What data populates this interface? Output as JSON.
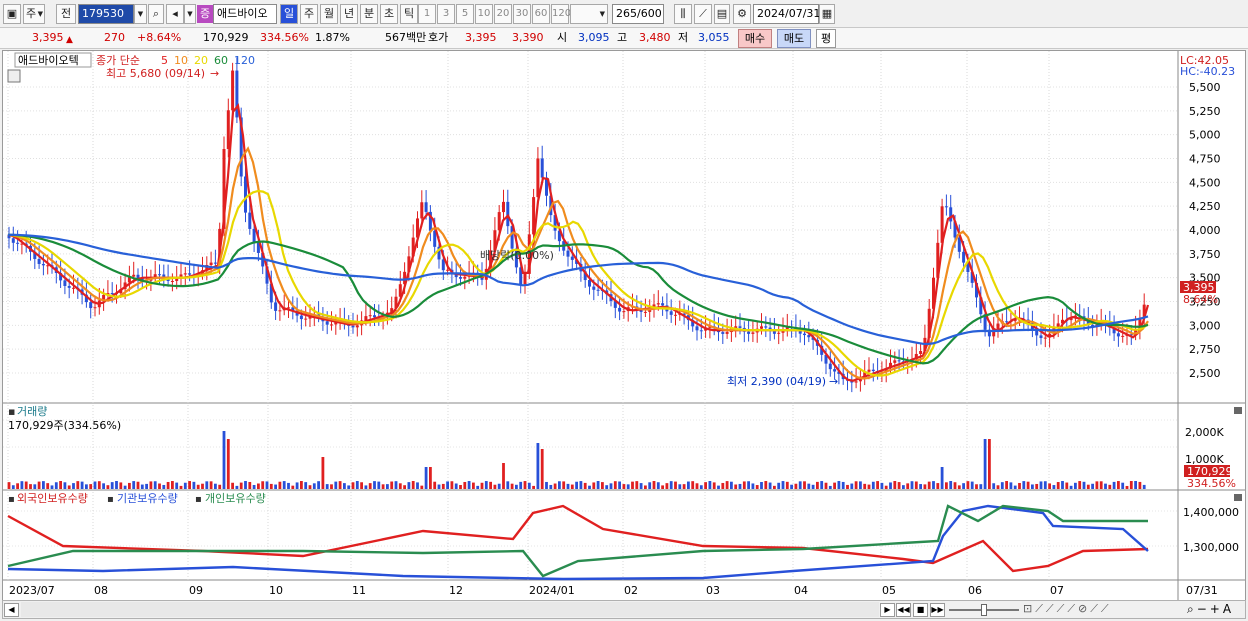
{
  "toolbar": {
    "market": "주",
    "prefix": "전",
    "code": "179530",
    "stock_name": "애드바이오",
    "stock_badge": "증",
    "periods": [
      "일",
      "주",
      "월",
      "년",
      "분",
      "초",
      "틱"
    ],
    "intervals": [
      "1",
      "3",
      "5",
      "10",
      "20",
      "30",
      "60",
      "120"
    ],
    "count": "265",
    "count_total": "/600",
    "date": "2024/07/31"
  },
  "quote": {
    "price": "3,395",
    "change": "270",
    "change_pct": "+8.64%",
    "volume": "170,929",
    "volume_pct": "334.56%",
    "turnover_pct": "1.87%",
    "amount": "567백만",
    "bid_label": "호가",
    "ask": "3,395",
    "bid": "3,390",
    "open_label": "시",
    "open": "3,095",
    "high_label": "고",
    "high": "3,480",
    "low_label": "저",
    "low": "3,055",
    "buy_label": "매수",
    "sell_label": "매도",
    "eval_label": "평"
  },
  "price_panel": {
    "title": "애드바이오텍",
    "legend_main": "종가 단순",
    "ma_labels": [
      "5",
      "10",
      "20",
      "60",
      "120"
    ],
    "ma_colors": [
      "#e02020",
      "#f08c1e",
      "#e8d800",
      "#1a8c3a",
      "#2860d8"
    ],
    "high_note": "최고 5,680 (09/14)",
    "low_note": "최저 2,390 (04/19)",
    "dividend_note": "배당락(0.00%)",
    "lc": "LC:42.05",
    "hc": "HC:-40.23",
    "price_tag": "3,395",
    "pct_tag": "8.64%",
    "y_ticks": [
      "5,500",
      "5,250",
      "5,000",
      "4,750",
      "4,500",
      "4,250",
      "4,000",
      "3,750",
      "3,500",
      "3,250",
      "3,000",
      "2,750",
      "2,500"
    ]
  },
  "volume_panel": {
    "title": "거래량",
    "value": "170,929주(334.56%)",
    "y_ticks": [
      "2,000K",
      "1,000K"
    ],
    "tag_value": "170,929",
    "tag_pct": "334.56%"
  },
  "holding_panel": {
    "legend": [
      "외국인보유수량",
      "기관보유수량",
      "개인보유수량"
    ],
    "legend_colors": [
      "#e02020",
      "#2850d8",
      "#2a8c50"
    ],
    "y_ticks": [
      "1,400,000",
      "1,300,000"
    ]
  },
  "x_axis": {
    "labels": [
      "2023/07",
      "08",
      "09",
      "10",
      "11",
      "12",
      "2024/01",
      "02",
      "03",
      "04",
      "05",
      "06",
      "07"
    ],
    "last": "07/31"
  }
}
